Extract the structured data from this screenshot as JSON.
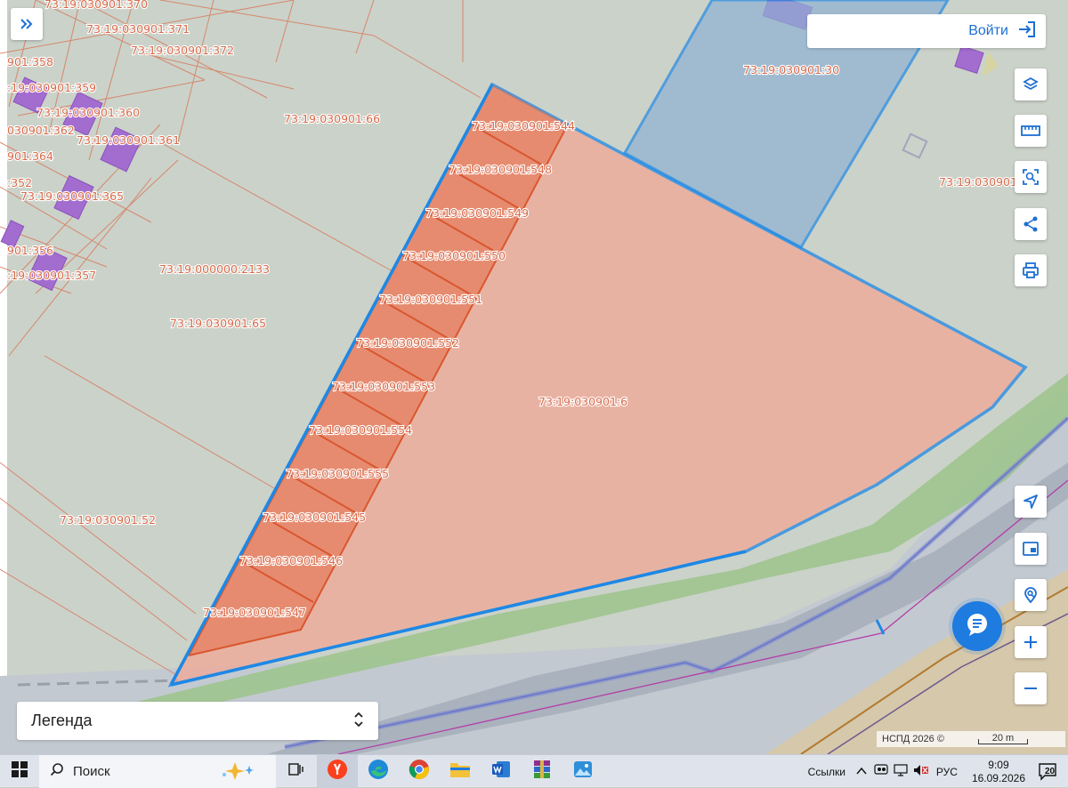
{
  "parcels": {
    "n370": "73:19:030901:370",
    "n371": "73:19:030901:371",
    "n372": "73:19:030901:372",
    "n358": "901:358",
    "n359": ":19:030901:359",
    "n360": "73:19:030901:360",
    "n361": "73:19:030901:361",
    "n362": "030901:362",
    "n364": "901:364",
    "n352": ":352",
    "n365": "73:19:030901:365",
    "n356": "901:356",
    "n357": ":19:030901:357",
    "n66": "73:19:030901:66",
    "n2133": "73:19:000000:2133",
    "n65": "73:19:030901:65",
    "n52": "73:19:030901:52",
    "n30": "73:19:030901:30",
    "n3": "73:19:030901:",
    "n6": "73:19:030901:6",
    "n544": "73:19:030901:544",
    "n548": "73:19:030901:548",
    "n549": "73:19:030901:549",
    "n550": "73:19:030901:550",
    "n551": "73:19:030901:551",
    "n552": "73:19:030901:552",
    "n553": "73:19:030901:553",
    "n554": "73:19:030901:554",
    "n555": "73:19:030901:555",
    "n545": "73:19:030901:545",
    "n546": "73:19:030901:546",
    "n547": "73:19:030901:547"
  },
  "ui": {
    "login_label": "Войти",
    "legend_label": "Легенда",
    "attribution": "НСПД 2026 ©",
    "scale_label": "20 m",
    "accent": "#1e7be0",
    "parcel_fill": "#f2a896",
    "parcel_border": "#1e88e5"
  },
  "controls": [
    {
      "name": "expand-panel",
      "icon": "chevrons-right-icon"
    },
    {
      "name": "layers",
      "icon": "layers-icon"
    },
    {
      "name": "measure",
      "icon": "ruler-icon"
    },
    {
      "name": "select-area",
      "icon": "select-area-icon"
    },
    {
      "name": "share",
      "icon": "share-icon"
    },
    {
      "name": "print",
      "icon": "printer-icon"
    },
    {
      "name": "my-location",
      "icon": "navigation-arrow-icon"
    },
    {
      "name": "minimap",
      "icon": "picture-in-picture-icon"
    },
    {
      "name": "search-location",
      "icon": "location-search-icon"
    },
    {
      "name": "zoom-in",
      "icon": "plus-icon"
    },
    {
      "name": "zoom-out",
      "icon": "minus-icon"
    }
  ],
  "taskbar": {
    "search_placeholder": "Поиск",
    "links_label": "Ссылки",
    "language": "РУС",
    "time": "9:09",
    "date": "16.09.2026",
    "notifications": "20",
    "apps": [
      "task-view",
      "yandex-browser",
      "edge",
      "chrome",
      "file-explorer",
      "word",
      "winrar",
      "photos"
    ]
  }
}
